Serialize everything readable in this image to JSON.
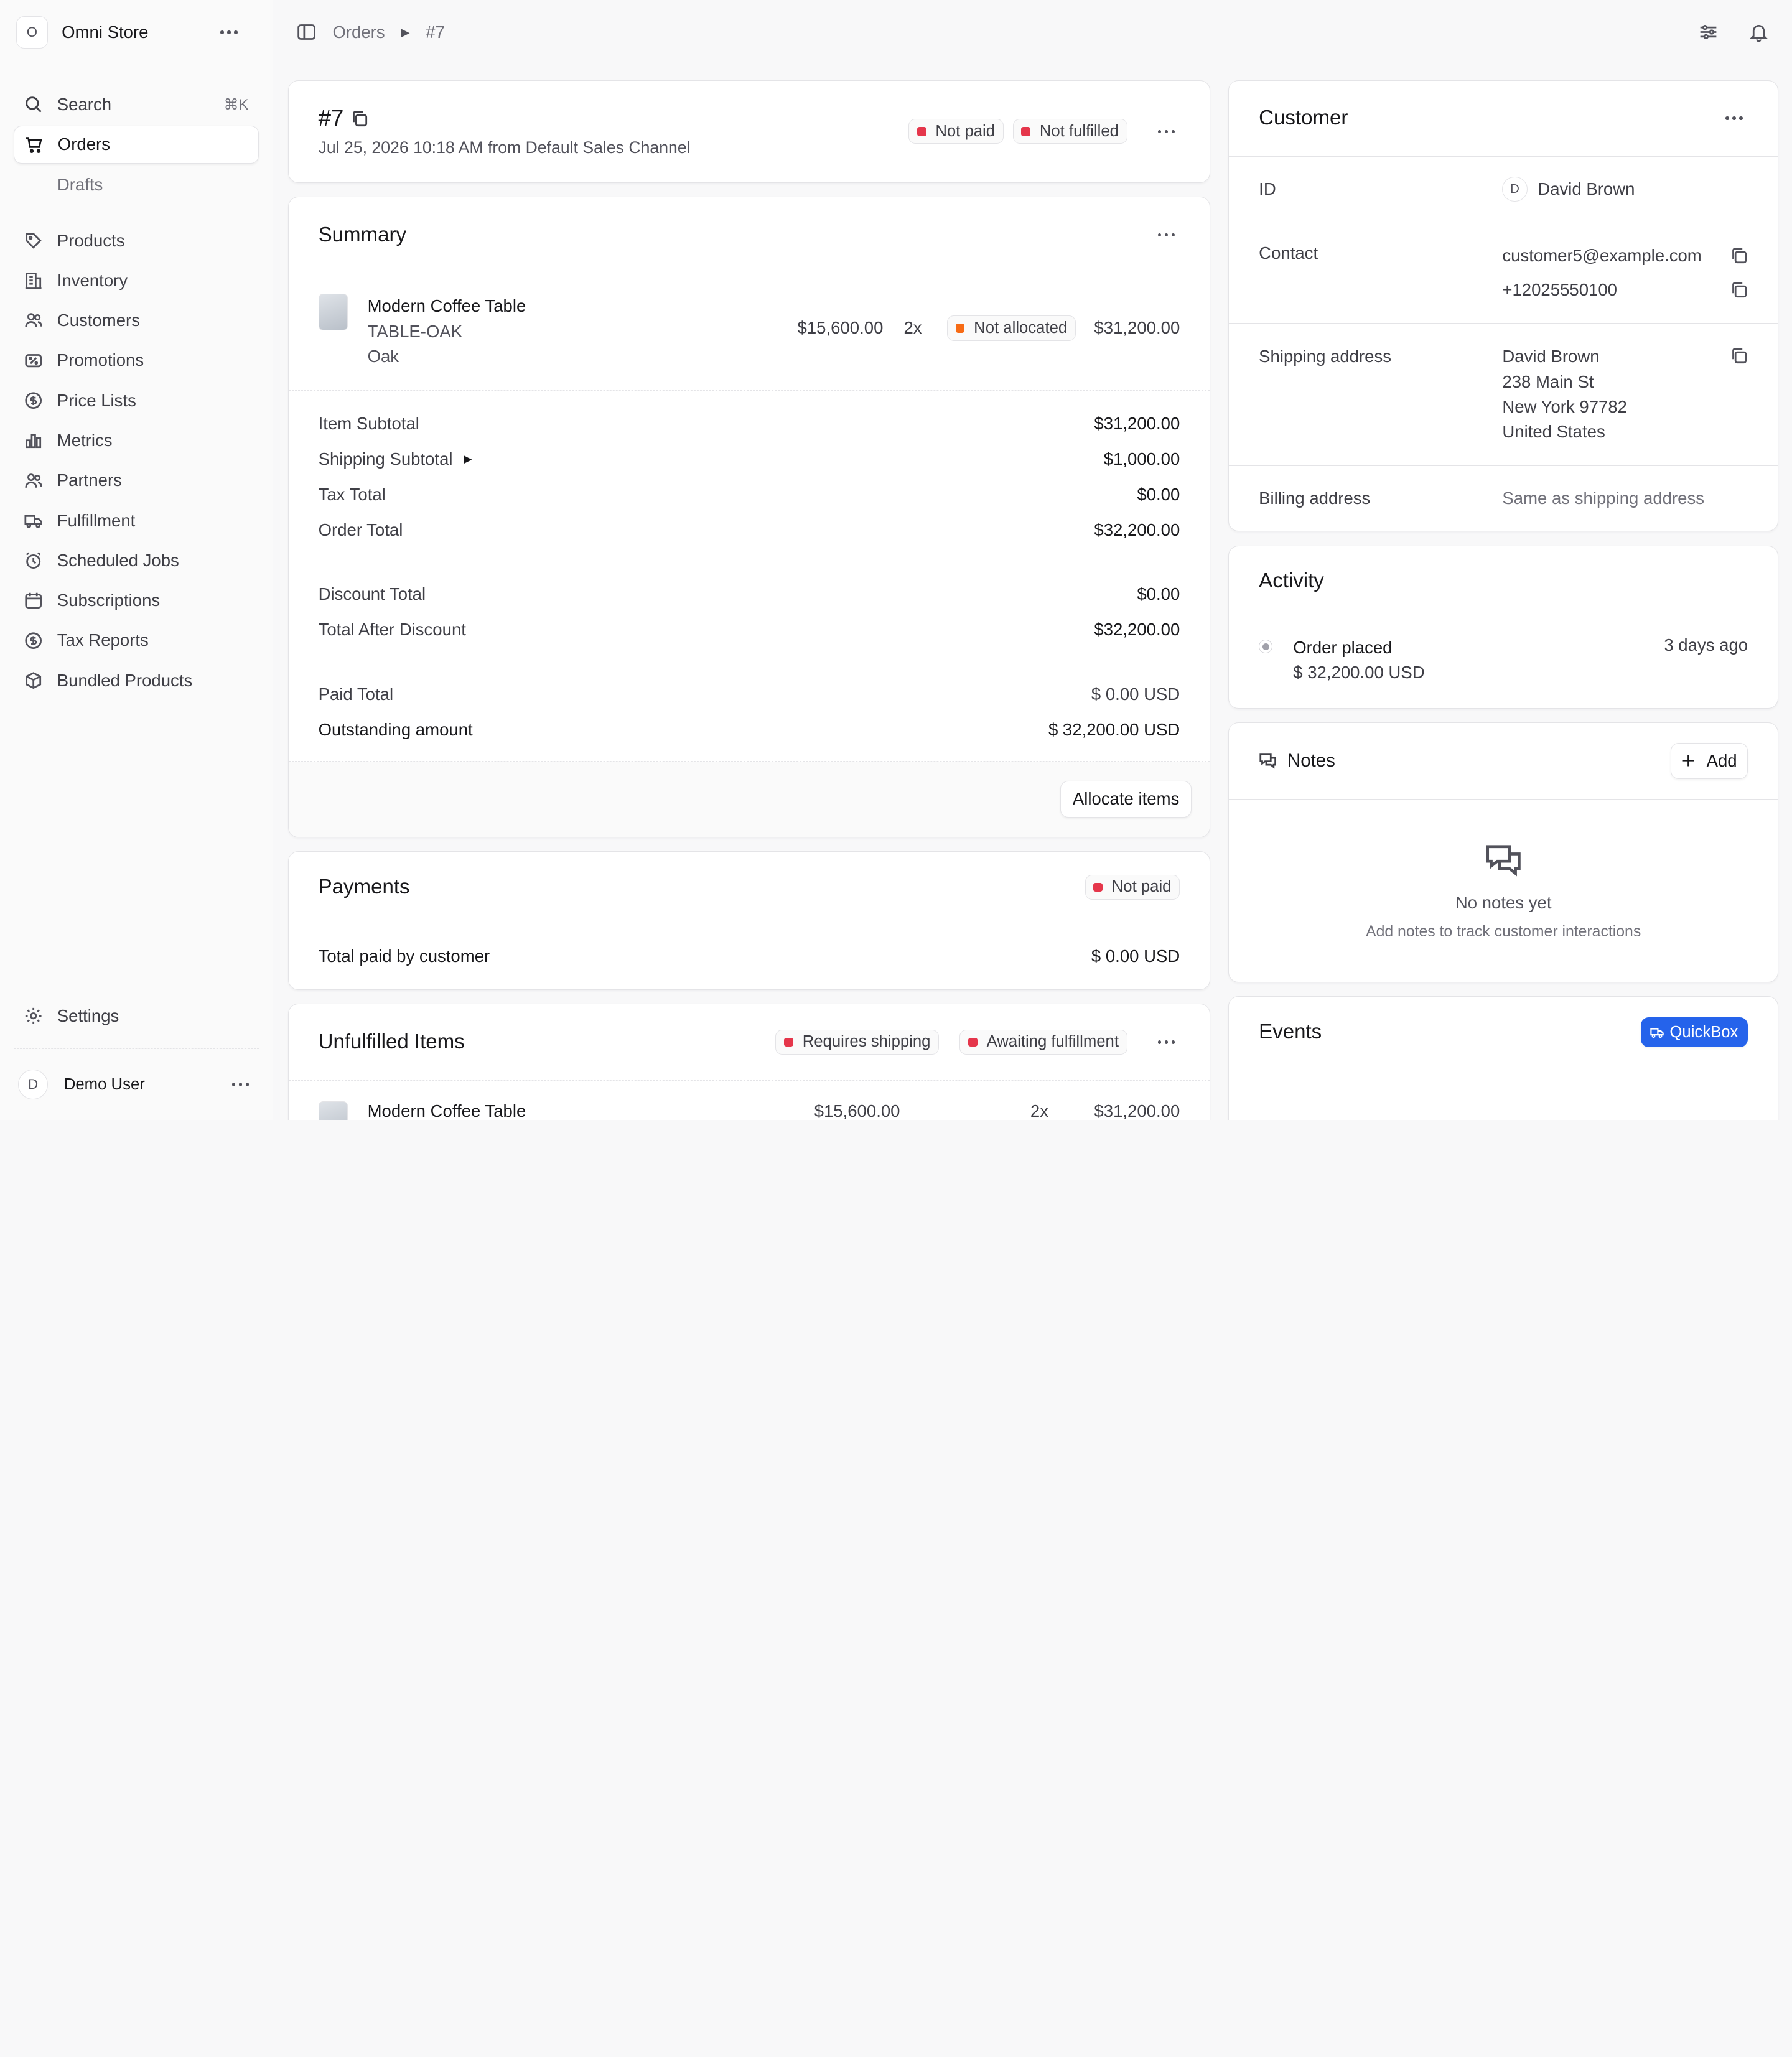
{
  "sidebar": {
    "store": {
      "initial": "O",
      "name": "Omni Store"
    },
    "search": {
      "label": "Search",
      "shortcut": "⌘K"
    },
    "items": [
      {
        "label": "Orders",
        "icon": "cart-icon",
        "active": true
      },
      {
        "label": "Drafts",
        "sub": true
      },
      {
        "label": "Products",
        "icon": "tag-icon"
      },
      {
        "label": "Inventory",
        "icon": "building-icon"
      },
      {
        "label": "Customers",
        "icon": "users-icon"
      },
      {
        "label": "Promotions",
        "icon": "receipt-percent-icon"
      },
      {
        "label": "Price Lists",
        "icon": "currency-icon"
      },
      {
        "label": "Metrics",
        "icon": "chart-bar-icon"
      },
      {
        "label": "Partners",
        "icon": "users-icon"
      },
      {
        "label": "Fulfillment",
        "icon": "truck-icon"
      },
      {
        "label": "Scheduled Jobs",
        "icon": "alarm-icon"
      },
      {
        "label": "Subscriptions",
        "icon": "calendar-icon"
      },
      {
        "label": "Tax Reports",
        "icon": "currency-icon"
      },
      {
        "label": "Bundled Products",
        "icon": "cube-icon"
      }
    ],
    "settings": "Settings",
    "user": {
      "initial": "D",
      "name": "Demo User"
    }
  },
  "breadcrumb": {
    "section": "Orders",
    "current": "#7"
  },
  "order": {
    "id": "#7",
    "subtitle": "Jul 25, 2026 10:18 AM from Default Sales Channel",
    "payment_badge": "Not paid",
    "fulfillment_badge": "Not fulfilled"
  },
  "summary": {
    "title": "Summary",
    "item": {
      "name": "Modern Coffee Table",
      "sku": "TABLE-OAK",
      "variant": "Oak",
      "unit_price": "$15,600.00",
      "qty": "2x",
      "status": "Not allocated",
      "total": "$31,200.00"
    },
    "totals": [
      {
        "label": "Item Subtotal",
        "value": "$31,200.00"
      },
      {
        "label": "Shipping Subtotal",
        "value": "$1,000.00"
      },
      {
        "label": "Tax Total",
        "value": "$0.00"
      },
      {
        "label": "Order Total",
        "value": "$32,200.00"
      }
    ],
    "discounts": [
      {
        "label": "Discount Total",
        "value": "$0.00"
      },
      {
        "label": "Total After Discount",
        "value": "$32,200.00"
      }
    ],
    "paid": [
      {
        "label": "Paid Total",
        "value": "$ 0.00 USD"
      },
      {
        "label": "Outstanding amount",
        "value": "$ 32,200.00 USD"
      }
    ],
    "allocate_button": "Allocate items"
  },
  "payments": {
    "title": "Payments",
    "badge": "Not paid",
    "total_label": "Total paid by customer",
    "total_value": "$ 0.00 USD"
  },
  "unfulfilled": {
    "title": "Unfulfilled Items",
    "badge_shipping": "Requires shipping",
    "badge_fulfillment": "Awaiting fulfillment",
    "item": {
      "name": "Modern Coffee Table",
      "unit_price": "$15,600.00",
      "qty": "2x",
      "total": "$31,200.00"
    }
  },
  "customer": {
    "title": "Customer",
    "id_label": "ID",
    "initial": "D",
    "name": "David Brown",
    "contact_label": "Contact",
    "email": "customer5@example.com",
    "phone": "+12025550100",
    "shipping_label": "Shipping address",
    "address": [
      "David Brown",
      "238 Main St",
      "New York 97782",
      "United States"
    ],
    "billing_label": "Billing address",
    "billing_value": "Same as shipping address"
  },
  "activity": {
    "title": "Activity",
    "event": "Order placed",
    "amount": "$ 32,200.00 USD",
    "time": "3 days ago"
  },
  "notes": {
    "title": "Notes",
    "add_label": "Add",
    "empty_title": "No notes yet",
    "empty_sub": "Add notes to track customer interactions"
  },
  "events": {
    "title": "Events",
    "button": "QuickBox"
  },
  "colors": {
    "red": "#e5364b",
    "orange": "#f76b15",
    "blue": "#2563eb"
  }
}
